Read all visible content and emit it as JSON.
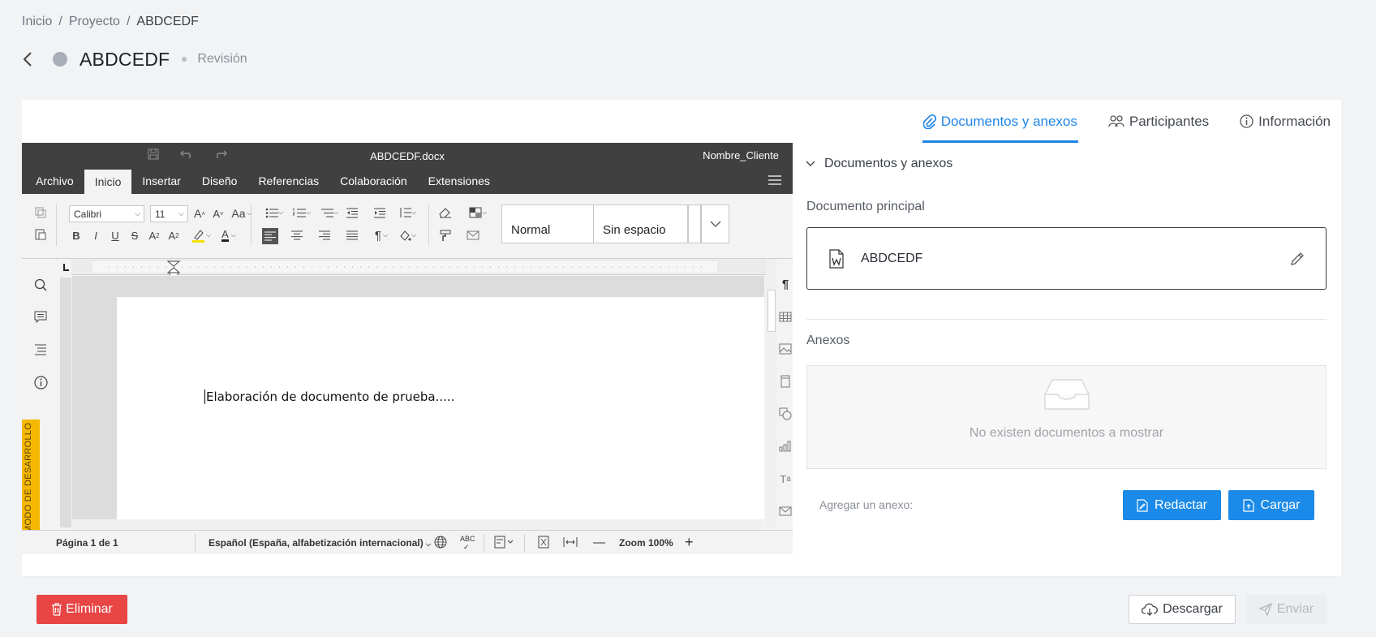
{
  "breadcrumb": {
    "home": "Inicio",
    "sep1": "/",
    "project": "Proyecto",
    "sep2": "/",
    "current": "ABDCEDF"
  },
  "header": {
    "title": "ABDCEDF",
    "stage": "Revisión"
  },
  "tabs": [
    {
      "label": "Documentos y anexos",
      "icon": "paperclip-icon",
      "active": true
    },
    {
      "label": "Participantes",
      "icon": "users-icon",
      "active": false
    },
    {
      "label": "Información",
      "icon": "info-icon",
      "active": false
    }
  ],
  "editor": {
    "file_name": "ABDCEDF.docx",
    "client_name": "Nombre_Cliente",
    "menu": [
      "Archivo",
      "Inicio",
      "Insertar",
      "Diseño",
      "Referencias",
      "Colaboración",
      "Extensiones"
    ],
    "active_menu": "Inicio",
    "font_name": "Calibri",
    "font_size": "11",
    "styles": [
      "Normal",
      "Sin espacio"
    ],
    "mode_label": "MODO DE DESARROLLO",
    "document_text": "Elaboración de documento de prueba.....",
    "status": {
      "page": "Página 1 de 1",
      "language": "Español (España, alfabetización internacional)",
      "zoom": "Zoom 100%"
    }
  },
  "side": {
    "section_title": "Documentos y anexos",
    "main_label": "Documento principal",
    "main_doc_name": "ABDCEDF",
    "annex_label": "Anexos",
    "empty_message": "No existen documentos a mostrar",
    "add_annex_label": "Agregar un anexo:",
    "draft_button": "Redactar",
    "upload_button": "Cargar"
  },
  "footer": {
    "delete_button": "Eliminar",
    "download_button": "Descargar",
    "send_button": "Enviar"
  },
  "colors": {
    "accent": "#1f86e6",
    "danger": "#e84545",
    "dev_mode": "#f5b800",
    "editor_bar": "#404040"
  }
}
